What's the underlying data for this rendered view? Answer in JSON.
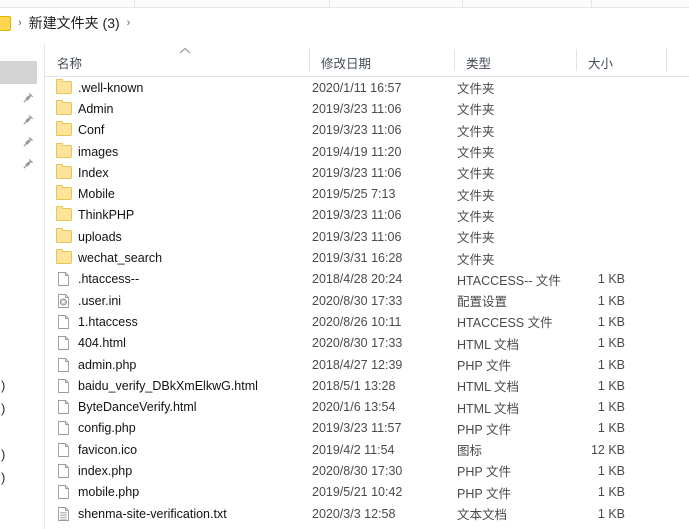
{
  "window": {
    "app": "File Explorer",
    "breadcrumb": {
      "path_label": "新建文件夹 (3)",
      "chevron": "›"
    }
  },
  "nav_pane": {
    "pin_icon": "pin-icon",
    "pin_count": 4,
    "clipped_labels": [
      ")",
      ")",
      ")",
      ")"
    ]
  },
  "columns": {
    "name": "名称",
    "date_modified": "修改日期",
    "type": "类型",
    "size": "大小",
    "sort_indicator": "ascending-caret-icon"
  },
  "items": [
    {
      "name": ".well-known",
      "date": "2020/1/11 16:57",
      "type": "文件夹",
      "size": "",
      "icon": "folder-icon"
    },
    {
      "name": "Admin",
      "date": "2019/3/23 11:06",
      "type": "文件夹",
      "size": "",
      "icon": "folder-icon"
    },
    {
      "name": "Conf",
      "date": "2019/3/23 11:06",
      "type": "文件夹",
      "size": "",
      "icon": "folder-icon"
    },
    {
      "name": "images",
      "date": "2019/4/19 11:20",
      "type": "文件夹",
      "size": "",
      "icon": "folder-icon"
    },
    {
      "name": "Index",
      "date": "2019/3/23 11:06",
      "type": "文件夹",
      "size": "",
      "icon": "folder-icon"
    },
    {
      "name": "Mobile",
      "date": "2019/5/25 7:13",
      "type": "文件夹",
      "size": "",
      "icon": "folder-icon"
    },
    {
      "name": "ThinkPHP",
      "date": "2019/3/23 11:06",
      "type": "文件夹",
      "size": "",
      "icon": "folder-icon"
    },
    {
      "name": "uploads",
      "date": "2019/3/23 11:06",
      "type": "文件夹",
      "size": "",
      "icon": "folder-icon"
    },
    {
      "name": "wechat_search",
      "date": "2019/3/31 16:28",
      "type": "文件夹",
      "size": "",
      "icon": "folder-icon"
    },
    {
      "name": ".htaccess--",
      "date": "2018/4/28 20:24",
      "type": "HTACCESS-- 文件",
      "size": "1 KB",
      "icon": "file-icon"
    },
    {
      "name": ".user.ini",
      "date": "2020/8/30 17:33",
      "type": "配置设置",
      "size": "1 KB",
      "icon": "config-icon"
    },
    {
      "name": "1.htaccess",
      "date": "2020/8/26 10:11",
      "type": "HTACCESS 文件",
      "size": "1 KB",
      "icon": "file-icon"
    },
    {
      "name": "404.html",
      "date": "2020/8/30 17:33",
      "type": "HTML 文档",
      "size": "1 KB",
      "icon": "file-icon"
    },
    {
      "name": "admin.php",
      "date": "2018/4/27 12:39",
      "type": "PHP 文件",
      "size": "1 KB",
      "icon": "file-icon"
    },
    {
      "name": "baidu_verify_DBkXmElkwG.html",
      "date": "2018/5/1 13:28",
      "type": "HTML 文档",
      "size": "1 KB",
      "icon": "file-icon"
    },
    {
      "name": "ByteDanceVerify.html",
      "date": "2020/1/6 13:54",
      "type": "HTML 文档",
      "size": "1 KB",
      "icon": "file-icon"
    },
    {
      "name": "config.php",
      "date": "2019/3/23 11:57",
      "type": "PHP 文件",
      "size": "1 KB",
      "icon": "file-icon"
    },
    {
      "name": "favicon.ico",
      "date": "2019/4/2 11:54",
      "type": "图标",
      "size": "12 KB",
      "icon": "file-icon"
    },
    {
      "name": "index.php",
      "date": "2020/8/30 17:30",
      "type": "PHP 文件",
      "size": "1 KB",
      "icon": "file-icon"
    },
    {
      "name": "mobile.php",
      "date": "2019/5/21 10:42",
      "type": "PHP 文件",
      "size": "1 KB",
      "icon": "file-icon"
    },
    {
      "name": "shenma-site-verification.txt",
      "date": "2020/3/3 12:58",
      "type": "文本文档",
      "size": "1 KB",
      "icon": "text-icon"
    }
  ],
  "colors": {
    "folder_fill": "#fde49a",
    "folder_stroke": "#e8c45c",
    "header_text": "#444c56",
    "row_text": "#121212",
    "secondary_text": "#4a4a4a",
    "nav_selection": "#d4d4d4"
  }
}
